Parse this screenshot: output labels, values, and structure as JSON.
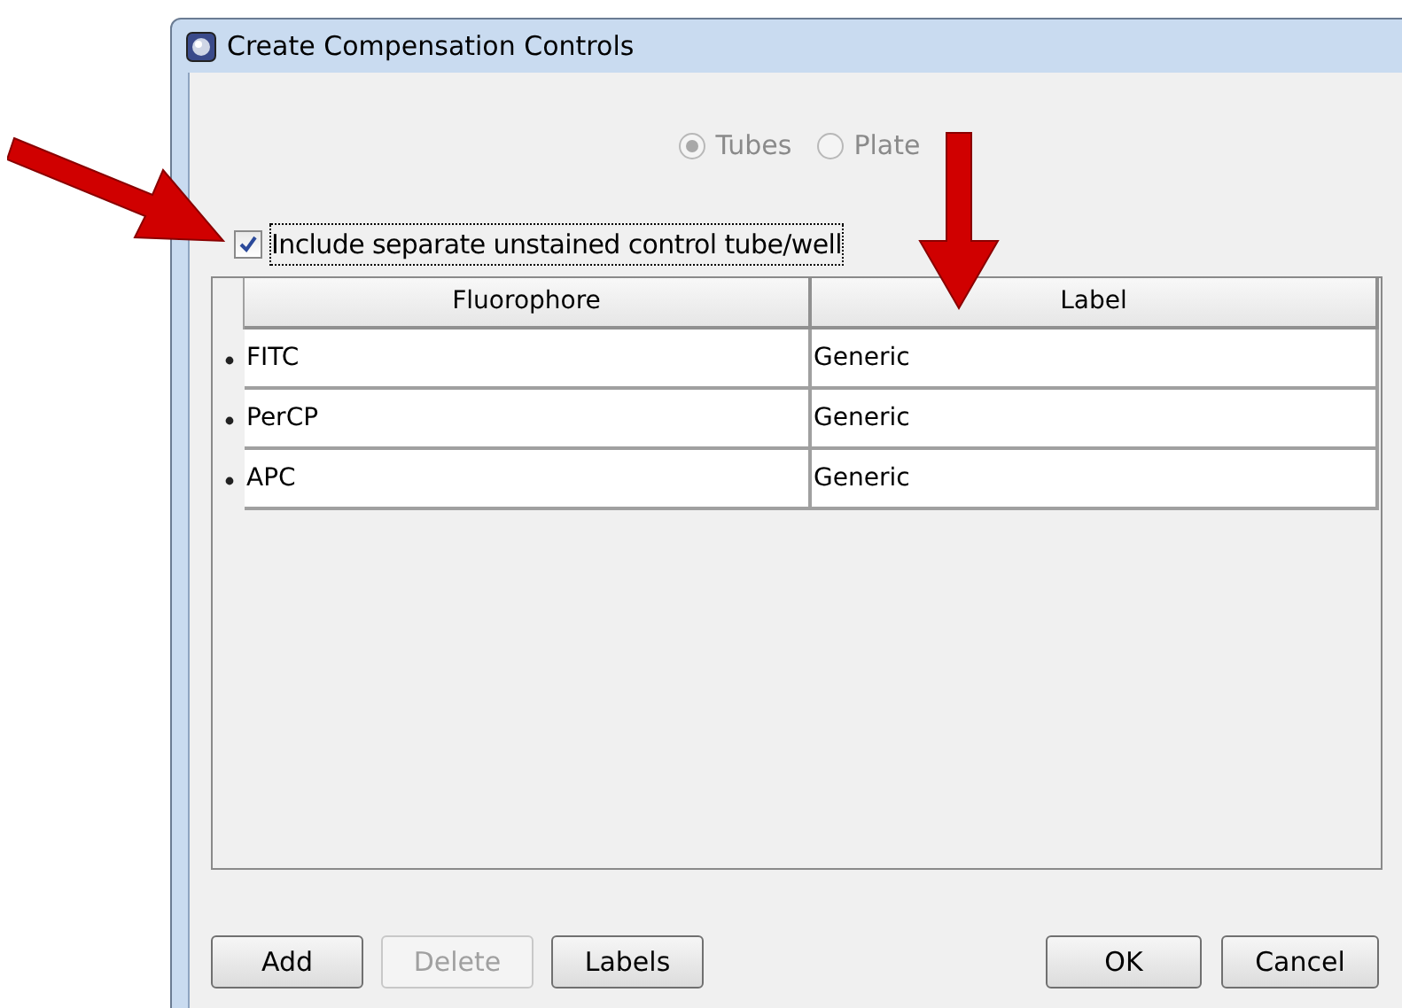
{
  "window": {
    "title": "Create Compensation Controls"
  },
  "radios": [
    {
      "label": "Tubes",
      "selected": true,
      "disabled": true
    },
    {
      "label": "Plate",
      "selected": false,
      "disabled": true
    }
  ],
  "checkbox": {
    "label": "Include separate unstained control tube/well",
    "checked": true,
    "focused": true
  },
  "table": {
    "columns": [
      "Fluorophore",
      "Label"
    ],
    "rows": [
      {
        "cells": [
          "FITC",
          "Generic"
        ]
      },
      {
        "cells": [
          "PerCP",
          "Generic"
        ]
      },
      {
        "cells": [
          "APC",
          "Generic"
        ]
      }
    ]
  },
  "buttons": [
    {
      "label": "Add",
      "disabled": false
    },
    {
      "label": "Delete",
      "disabled": true
    },
    {
      "label": "Labels",
      "disabled": false
    },
    {
      "label": "OK",
      "disabled": false
    },
    {
      "label": "Cancel",
      "disabled": false
    }
  ]
}
